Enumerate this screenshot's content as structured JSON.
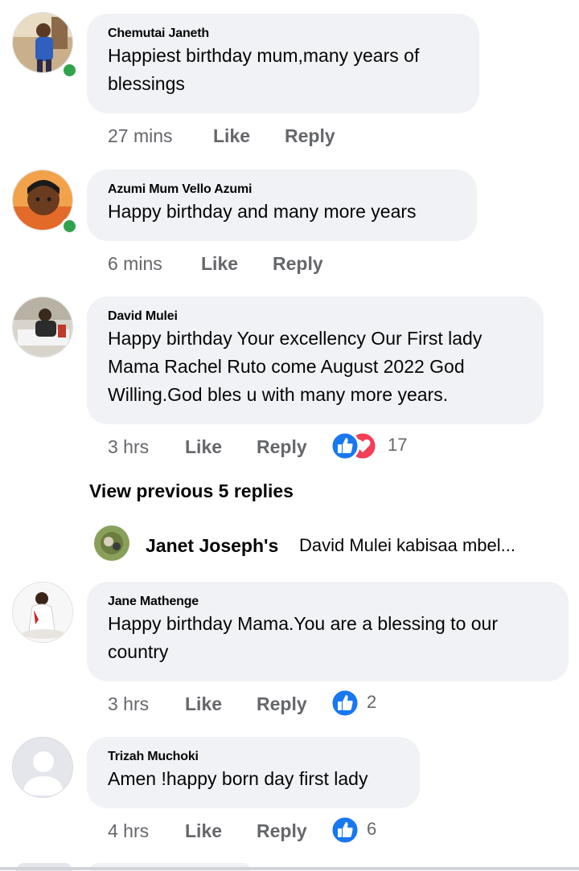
{
  "comments": [
    {
      "name": "Chemutai Janeth",
      "lines": [
        "Happiest birthday mum,many years of",
        "blessings"
      ],
      "time": "27 mins",
      "like_label": "Like",
      "reply_label": "Reply",
      "online": true
    },
    {
      "name": "Azumi Mum Vello Azumi",
      "lines": [
        "Happy birthday and many more years"
      ],
      "time": "6 mins",
      "like_label": "Like",
      "reply_label": "Reply",
      "online": true
    },
    {
      "name": "David Mulei",
      "lines": [
        "Happy birthday Your excellency Our First lady",
        "Mama Rachel Ruto come  August 2022 God",
        "Willing.God bles u with many more years."
      ],
      "time": "3 hrs",
      "like_label": "Like",
      "reply_label": "Reply",
      "reactions": [
        "like-icon",
        "love-icon"
      ],
      "reaction_count": "17"
    },
    {
      "name": "Jane Mathenge",
      "lines": [
        "Happy birthday Mama.You are  a blessing to our",
        "country"
      ],
      "time": "3 hrs",
      "like_label": "Like",
      "reply_label": "Reply",
      "reactions": [
        "like-icon"
      ],
      "reaction_count": "2"
    },
    {
      "name": "Trizah Muchoki",
      "lines": [
        "Amen !happy born day first lady"
      ],
      "time": "4 hrs",
      "like_label": "Like",
      "reply_label": "Reply",
      "reactions": [
        "like-icon"
      ],
      "reaction_count": "6"
    }
  ],
  "view_previous": "View previous 5 replies",
  "reply_preview": {
    "name": "Janet Joseph's",
    "text": "David Mulei kabisaa mbel..."
  },
  "colors": {
    "bubble": "#f0f2f5",
    "online": "#31a24c",
    "like_blue": "#1877f2",
    "love_red": "#f33e58",
    "meta_grey": "#65676b"
  }
}
